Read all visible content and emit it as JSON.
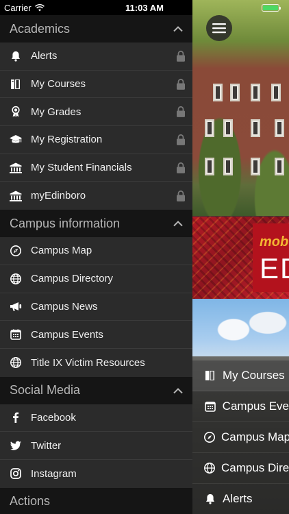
{
  "status_bar": {
    "carrier": "Carrier",
    "time": "11:03 AM",
    "battery_level": 1.0
  },
  "colors": {
    "drawer_bg": "#2b2b2b",
    "header_bg": "#151515",
    "battery": "#4cd964",
    "banner_red": "#b01a24",
    "banner_gold": "#f3b733"
  },
  "drawer": {
    "sections": [
      {
        "title": "Academics",
        "expanded": true,
        "items": [
          {
            "label": "Alerts",
            "icon": "bell-icon",
            "locked": true
          },
          {
            "label": "My Courses",
            "icon": "book-icon",
            "locked": true
          },
          {
            "label": "My Grades",
            "icon": "award-icon",
            "locked": true
          },
          {
            "label": "My Registration",
            "icon": "graduation-cap-icon",
            "locked": true
          },
          {
            "label": "My Student Financials",
            "icon": "bank-icon",
            "locked": true
          },
          {
            "label": "myEdinboro",
            "icon": "bank-icon",
            "locked": true
          }
        ]
      },
      {
        "title": "Campus information",
        "expanded": true,
        "items": [
          {
            "label": "Campus Map",
            "icon": "compass-icon",
            "locked": false
          },
          {
            "label": "Campus Directory",
            "icon": "globe-icon",
            "locked": false
          },
          {
            "label": "Campus News",
            "icon": "megaphone-icon",
            "locked": false
          },
          {
            "label": "Campus Events",
            "icon": "calendar-icon",
            "locked": false
          },
          {
            "label": "Title IX Victim Resources",
            "icon": "globe-icon",
            "locked": false
          }
        ]
      },
      {
        "title": "Social Media",
        "expanded": true,
        "items": [
          {
            "label": "Facebook",
            "icon": "facebook-icon",
            "locked": false
          },
          {
            "label": "Twitter",
            "icon": "twitter-icon",
            "locked": false
          },
          {
            "label": "Instagram",
            "icon": "instagram-icon",
            "locked": false
          }
        ]
      },
      {
        "title": "Actions",
        "expanded": false,
        "items": []
      }
    ]
  },
  "background": {
    "banner": {
      "line1": "mob",
      "line2": "ED"
    },
    "quick_links": [
      {
        "label": "My Courses",
        "icon": "book-icon"
      },
      {
        "label": "Campus Eve",
        "icon": "calendar-icon"
      },
      {
        "label": "Campus Map",
        "icon": "compass-icon"
      },
      {
        "label": "Campus Dire",
        "icon": "globe-icon"
      },
      {
        "label": "Alerts",
        "icon": "bell-icon"
      }
    ]
  }
}
